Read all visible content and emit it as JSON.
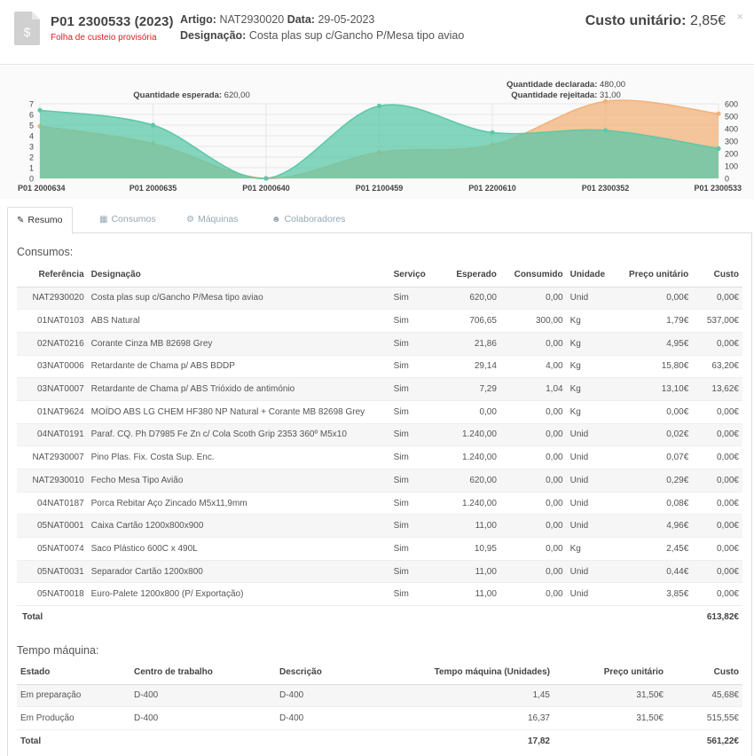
{
  "header": {
    "title": "P01 2300533 (2023)",
    "subtitle": "Folha de custeio provisória",
    "artigo_label": "Artigo:",
    "artigo_value": "NAT2930020",
    "data_label": "Data:",
    "data_value": "29-05-2023",
    "designacao_label": "Designação:",
    "designacao_value": "Costa plas sup c/Gancho P/Mesa tipo aviao",
    "cost_label": "Custo unitário:",
    "cost_value": "2,85€",
    "close_glyph": "×"
  },
  "chart_data": {
    "type": "area",
    "categories": [
      "P01 2000634",
      "P01 2000635",
      "P01 2000640",
      "P01 2100459",
      "P01 2200610",
      "P01 2300352",
      "P01 2300533"
    ],
    "series": [
      {
        "values": [
          6.4,
          5.0,
          0.0,
          6.8,
          4.3,
          4.5,
          2.8
        ],
        "color": "#5cc8a8",
        "axis": "left"
      },
      {
        "values": [
          420,
          280,
          0,
          210,
          270,
          620,
          520
        ],
        "color": "#f2b27a",
        "axis": "right"
      }
    ],
    "y_left": {
      "ticks": [
        "0",
        "1",
        "2",
        "3",
        "4",
        "5",
        "6",
        "7"
      ],
      "ylim": [
        0,
        7
      ]
    },
    "y_right": {
      "ticks": [
        "0",
        "100",
        "200",
        "300",
        "400",
        "500",
        "600"
      ],
      "ylim": [
        0,
        600
      ]
    },
    "annotations": [
      {
        "label": "Quantidade esperada:",
        "value": "620,00"
      },
      {
        "label": "Quantidade declarada:",
        "value": "480,00"
      },
      {
        "label": "Quantidade rejeitada:",
        "value": "31,00"
      }
    ]
  },
  "tabs": [
    {
      "label": "Resumo",
      "icon": "edit-icon",
      "glyph": "✎",
      "active": true
    },
    {
      "label": "Consumos",
      "icon": "cubes-icon",
      "glyph": "▦",
      "active": false
    },
    {
      "label": "Máquinas",
      "icon": "cogs-icon",
      "glyph": "⚙",
      "active": false
    },
    {
      "label": "Colaboradores",
      "icon": "users-icon",
      "glyph": "☻",
      "active": false
    }
  ],
  "consumos": {
    "title": "Consumos:",
    "columns": [
      "Referência",
      "Designação",
      "Serviço",
      "Esperado",
      "Consumido",
      "Unidade",
      "Preço unitário",
      "Custo"
    ],
    "rows": [
      [
        "NAT2930020",
        "Costa plas sup c/Gancho P/Mesa tipo aviao",
        "Sim",
        "620,00",
        "0,00",
        "Unid",
        "0,00€",
        "0,00€"
      ],
      [
        "01NAT0103",
        "ABS Natural",
        "Sim",
        "706,65",
        "300,00",
        "Kg",
        "1,79€",
        "537,00€"
      ],
      [
        "02NAT0216",
        "Corante Cinza MB 82698 Grey",
        "Sim",
        "21,86",
        "0,00",
        "Kg",
        "4,95€",
        "0,00€"
      ],
      [
        "03NAT0006",
        "Retardante de Chama p/ ABS BDDP",
        "Sim",
        "29,14",
        "4,00",
        "Kg",
        "15,80€",
        "63,20€"
      ],
      [
        "03NAT0007",
        "Retardante de Chama p/ ABS Trióxido de antimónio",
        "Sim",
        "7,29",
        "1,04",
        "Kg",
        "13,10€",
        "13,62€"
      ],
      [
        "01NAT9624",
        "MOÍDO ABS LG CHEM HF380 NP Natural + Corante MB 82698 Grey",
        "Sim",
        "0,00",
        "0,00",
        "Kg",
        "0,00€",
        "0,00€"
      ],
      [
        "04NAT0191",
        "Paraf. CQ. Ph D7985 Fe Zn c/ Cola Scoth Grip 2353 360º M5x10",
        "Sim",
        "1.240,00",
        "0,00",
        "Unid",
        "0,02€",
        "0,00€"
      ],
      [
        "NAT2930007",
        "Pino Plas. Fix. Costa Sup. Enc.",
        "Sim",
        "1.240,00",
        "0,00",
        "Unid",
        "0,07€",
        "0,00€"
      ],
      [
        "NAT2930010",
        "Fecho Mesa Tipo Avião",
        "Sim",
        "620,00",
        "0,00",
        "Unid",
        "0,29€",
        "0,00€"
      ],
      [
        "04NAT0187",
        "Porca Rebitar Aço Zincado M5x11,9mm",
        "Sim",
        "1.240,00",
        "0,00",
        "Unid",
        "0,08€",
        "0,00€"
      ],
      [
        "05NAT0001",
        "Caixa Cartão 1200x800x900",
        "Sim",
        "11,00",
        "0,00",
        "Unid",
        "4,96€",
        "0,00€"
      ],
      [
        "05NAT0074",
        "Saco Plástico 600C x 490L",
        "Sim",
        "10,95",
        "0,00",
        "Kg",
        "2,45€",
        "0,00€"
      ],
      [
        "05NAT0031",
        "Separador Cartão 1200x800",
        "Sim",
        "11,00",
        "0,00",
        "Unid",
        "0,44€",
        "0,00€"
      ],
      [
        "05NAT0018",
        "Euro-Palete 1200x800 (P/ Exportação)",
        "Sim",
        "11,00",
        "0,00",
        "Unid",
        "3,85€",
        "0,00€"
      ]
    ],
    "total_label": "Total",
    "total_value": "613,82€"
  },
  "tempo": {
    "title": "Tempo máquina:",
    "columns": [
      "Estado",
      "Centro de trabalho",
      "Descrição",
      "Tempo máquina (Unidades)",
      "Preço unitário",
      "Custo"
    ],
    "rows": [
      [
        "Em preparação",
        "D-400",
        "D-400",
        "1,45",
        "31,50€",
        "45,68€"
      ],
      [
        "Em Produção",
        "D-400",
        "D-400",
        "16,37",
        "31,50€",
        "515,55€"
      ]
    ],
    "total_label": "Total",
    "total_tempo": "17,82",
    "total_value": "561,22€"
  }
}
